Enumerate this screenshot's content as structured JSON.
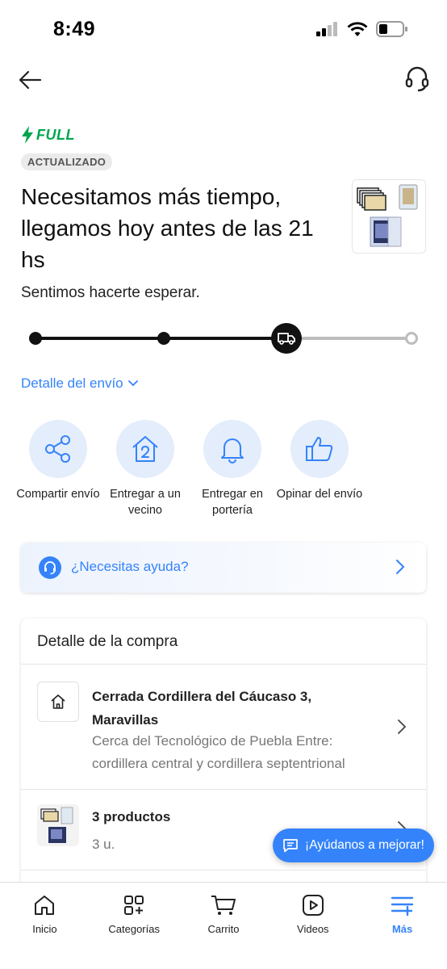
{
  "status_bar": {
    "time": "8:49"
  },
  "shipment": {
    "badge": "FULL",
    "updated_label": "ACTUALIZADO",
    "title": "Necesitamos más tiempo, llegamos hoy antes de las 21 hs",
    "subtitle": "Sentimos hacerte esperar.",
    "progress": {
      "steps_total": 4,
      "current_step": 3
    },
    "detail_link": "Detalle del envío"
  },
  "actions": [
    {
      "label": "Compartir envío",
      "icon": "share-icon"
    },
    {
      "label": "Entregar a un vecino",
      "icon": "neighbor-house-icon"
    },
    {
      "label": "Entregar en portería",
      "icon": "bell-icon"
    },
    {
      "label": "Opinar del envío",
      "icon": "thumbs-up-icon"
    }
  ],
  "help": {
    "label": "¿Necesitas ayuda?"
  },
  "purchase": {
    "title": "Detalle de la compra",
    "address": {
      "title": "Cerrada Cordillera del Cáucaso 3, Maravillas",
      "detail": "Cerca del Tecnológico de Puebla Entre: cordillera central y cordillera septentrional"
    },
    "products": {
      "title": "3 productos",
      "qty": "3 u."
    }
  },
  "feedback": {
    "label": "¡Ayúdanos a mejorar!"
  },
  "bottom_nav": [
    {
      "label": "Inicio",
      "icon": "home-icon"
    },
    {
      "label": "Categorías",
      "icon": "categories-icon"
    },
    {
      "label": "Carrito",
      "icon": "cart-icon"
    },
    {
      "label": "Videos",
      "icon": "video-icon"
    },
    {
      "label": "Más",
      "icon": "more-icon",
      "active": true
    }
  ],
  "colors": {
    "accent": "#3483fa",
    "full_green": "#00a650",
    "light_blue": "#e3edfb"
  }
}
